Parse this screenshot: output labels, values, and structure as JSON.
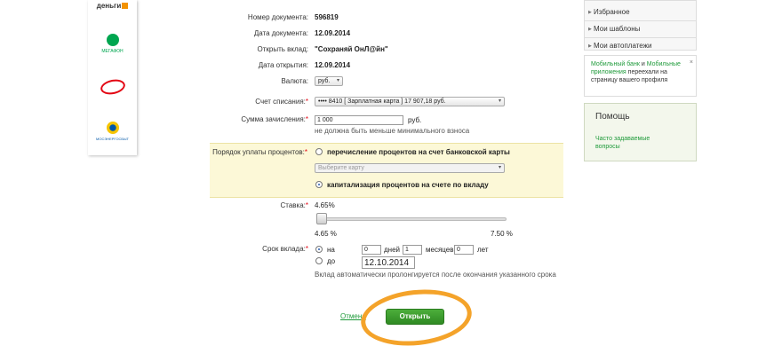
{
  "partners": {
    "dengi": "деньги",
    "megafon": "МЕГАФОН",
    "energo": "МОСЭНЕРГОСБЫТ"
  },
  "form": {
    "doc_number_label": "Номер документа:",
    "doc_number": "596819",
    "doc_date_label": "Дата документа:",
    "doc_date": "12.09.2014",
    "deposit_label": "Открыть вклад:",
    "deposit": "\"Сохраняй ОнЛ@йн\"",
    "open_date_label": "Дата открытия:",
    "open_date": "12.09.2014",
    "currency_label": "Валюта:",
    "currency": "руб.",
    "account_label": "Счет списания:",
    "account": "•••• 8410   [ Зарплатная карта ] 17 907,18   руб.",
    "amount_label": "Сумма зачисления:",
    "amount": "1 000",
    "amount_unit": "руб.",
    "amount_hint": "не должна быть меньше минимального взноса",
    "interest_label": "Порядок уплаты процентов:",
    "interest_option1": "перечисление процентов на счет банковской карты",
    "card_placeholder": "Выберите карту",
    "interest_option2": "капитализация процентов на счете по вкладу",
    "rate_label": "Ставка:",
    "rate_value": "4.65%",
    "rate_min": "4.65 %",
    "rate_max": "7.50 %",
    "term_label": "Срок вклада:",
    "term_on": "на",
    "term_days": "0",
    "term_days_label": "дней",
    "term_months": "1",
    "term_months_label": "месяцев",
    "term_years": "0",
    "term_years_label": "лет",
    "term_until": "до",
    "term_until_date": "12.10.2014",
    "term_hint": "Вклад автоматически пролонгируется после окончания указанного срока",
    "cancel": "Отмена",
    "submit": "Открыть",
    "required_mark": "*"
  },
  "sidebar": {
    "menu": [
      "Избранное",
      "Мои шаблоны",
      "Мои автоплатежи"
    ],
    "notice_part1": "Мобильный банк",
    "notice_part2": " и ",
    "notice_part3": "Мобильные приложения",
    "notice_part4": " переехали на страницу вашего профиля",
    "notice_close": "×",
    "help_title": "Помощь",
    "help_link": "Часто задаваемые вопросы"
  },
  "colors": {
    "accent_green": "#1e9a3a",
    "button_green": "#3a9a2c",
    "highlight": "#f4a32a",
    "yellow_bg": "#fcf8d7"
  }
}
